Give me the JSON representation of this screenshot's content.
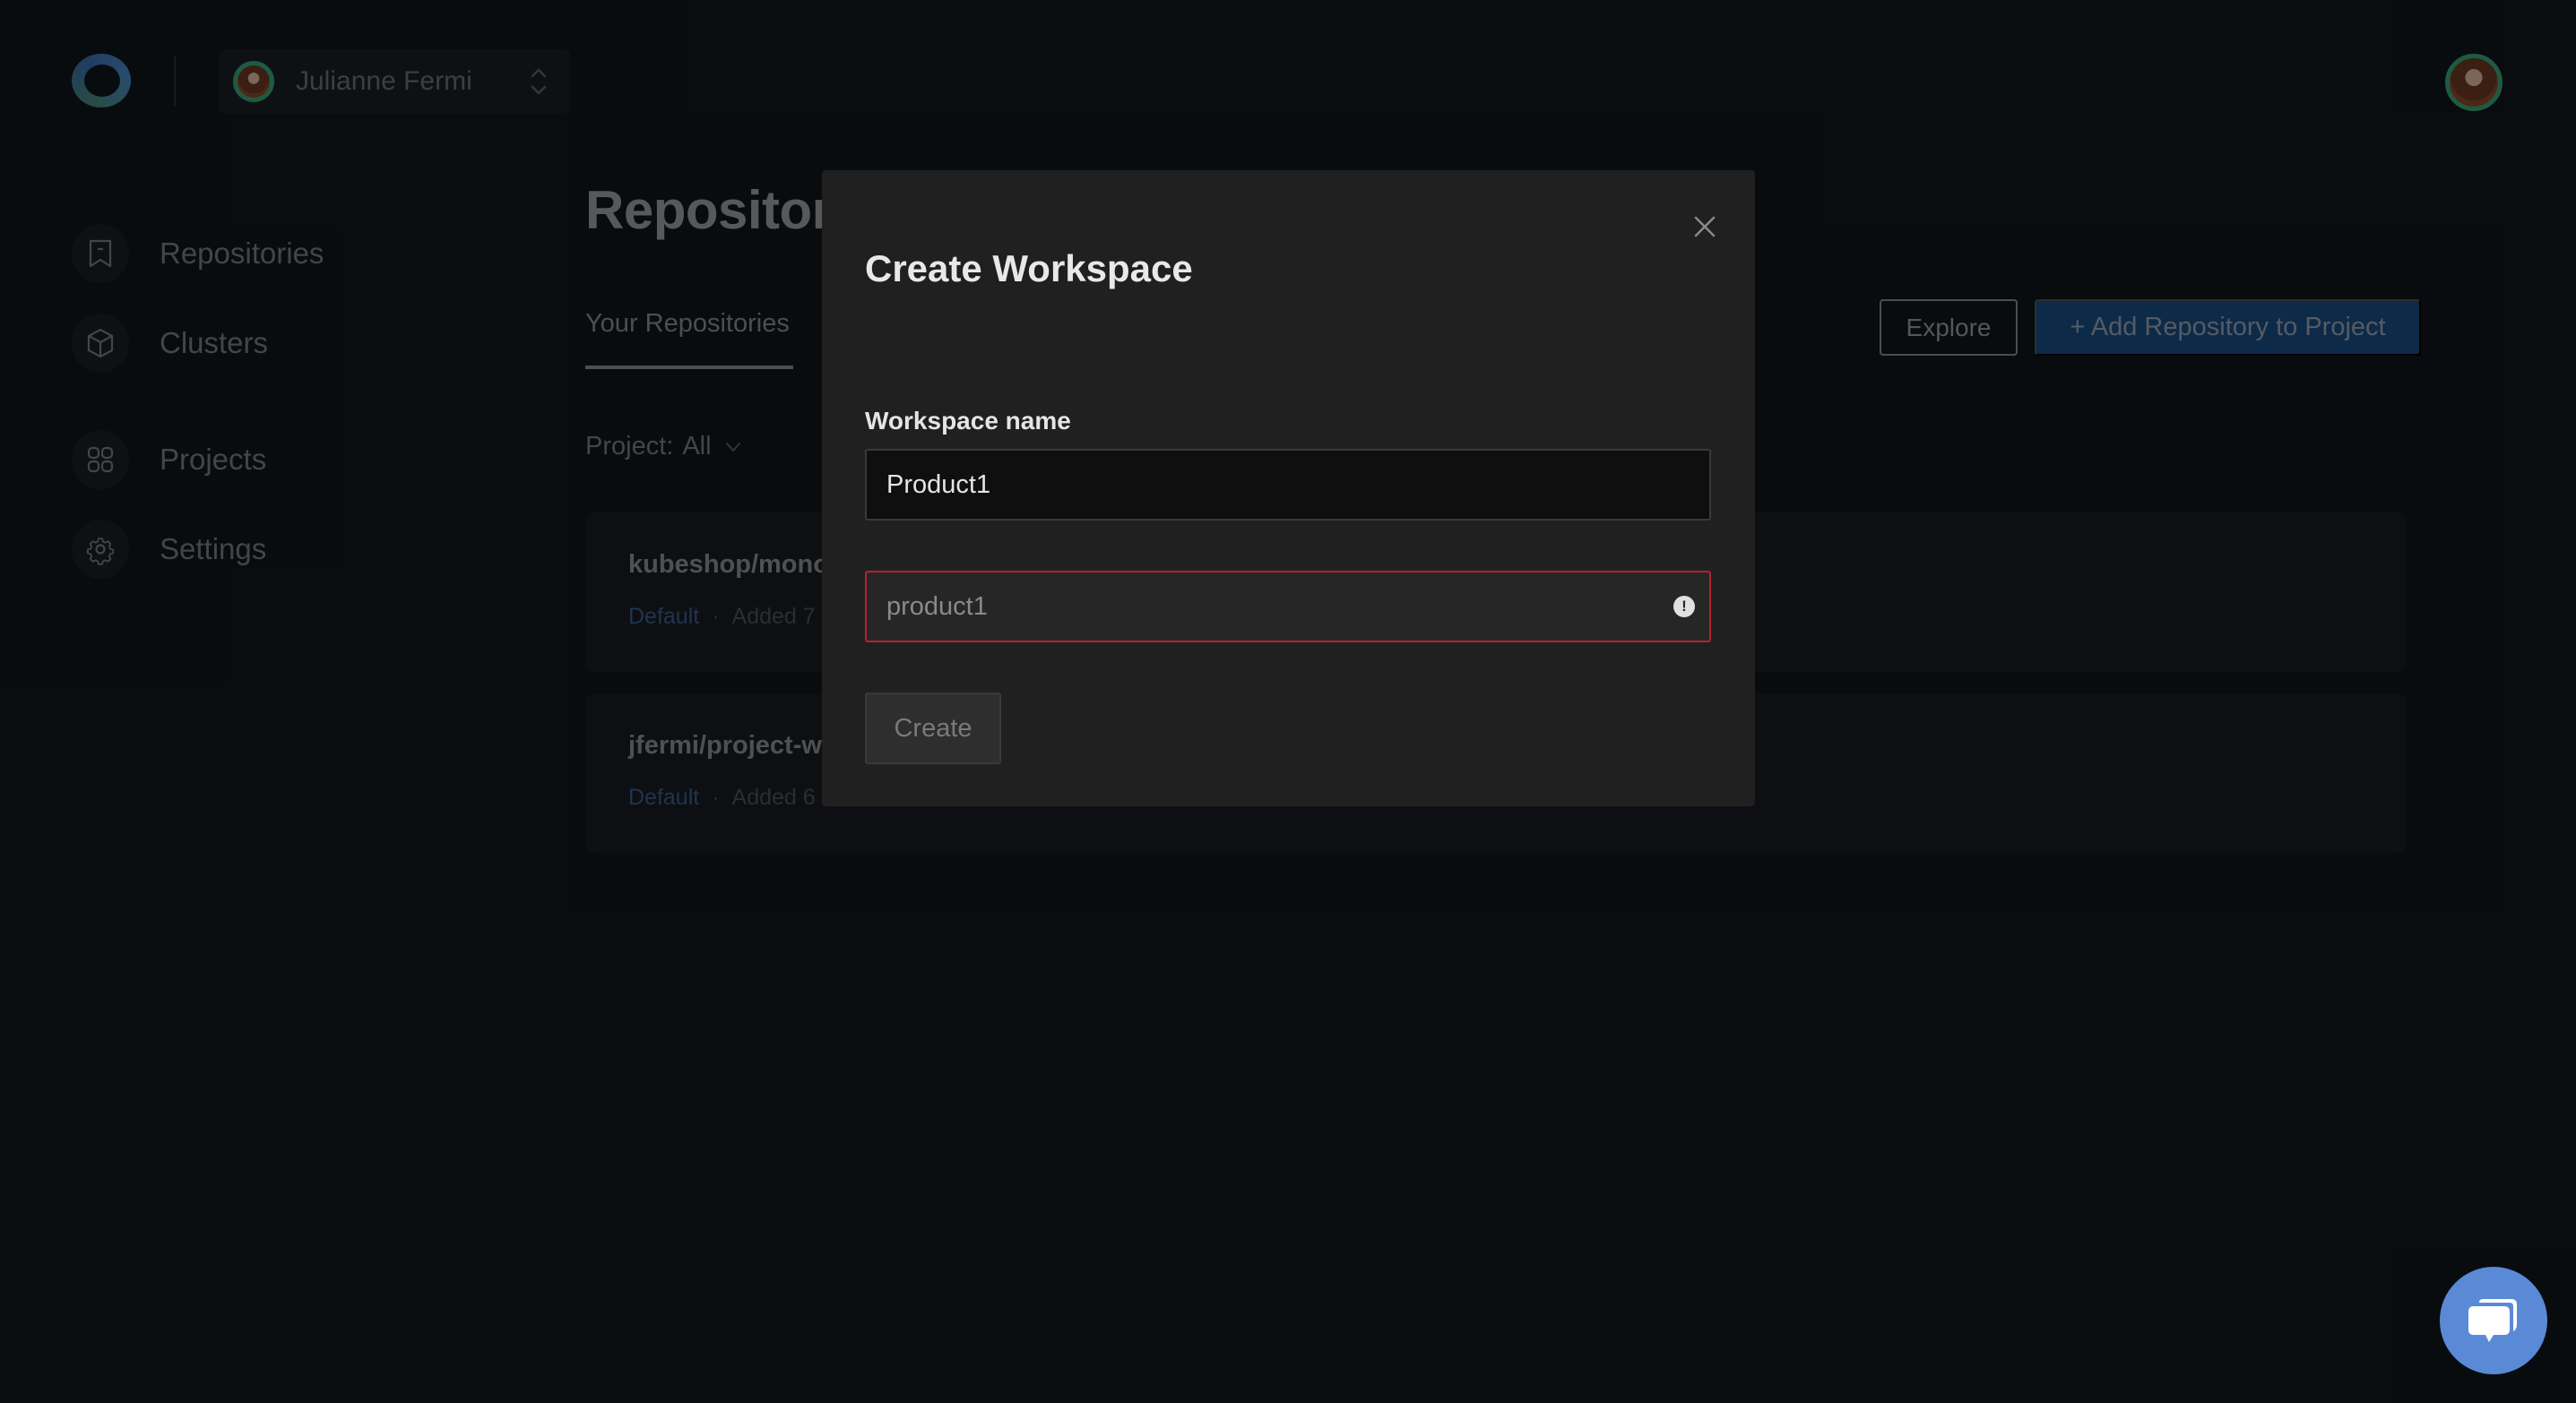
{
  "header": {
    "logo": "app-logo",
    "user_switcher": {
      "name": "Julianne Fermi",
      "icon": "chevron-up-down-icon"
    },
    "profile_avatar": "user-avatar"
  },
  "sidebar": {
    "items": [
      {
        "label": "Repositories",
        "icon": "bookmark-icon"
      },
      {
        "label": "Clusters",
        "icon": "cube-icon"
      },
      {
        "label": "Projects",
        "icon": "grid-icon"
      },
      {
        "label": "Settings",
        "icon": "gear-icon"
      }
    ]
  },
  "main": {
    "title": "Repositories",
    "tabs": [
      {
        "label": "Your Repositories",
        "active": true
      }
    ],
    "project_filter": {
      "label": "Project:",
      "value": "All"
    },
    "buttons": {
      "explore": "Explore",
      "add_repository": "+ Add Repository to Project"
    },
    "repositories": [
      {
        "name": "kubeshop/mono",
        "tag": "Default",
        "added": "Added 7"
      },
      {
        "name": "jfermi/project-w",
        "tag": "Default",
        "added": "Added 6"
      }
    ]
  },
  "modal": {
    "title": "Create Workspace",
    "close_icon": "close-icon",
    "field_label": "Workspace name",
    "name_value": "Product1",
    "slug_value": "product1",
    "slug_state": "error",
    "error_icon": "exclamation-circle-icon",
    "create_label": "Create",
    "create_disabled": true
  },
  "chat": {
    "icon": "chat-bubbles-icon"
  },
  "colors": {
    "accent_blue": "#1b4d86",
    "error_red": "#b3232b",
    "avatar_ring": "#3aa57a",
    "tag_blue": "#3e5d92",
    "chat_blue": "#5a8ad6"
  }
}
